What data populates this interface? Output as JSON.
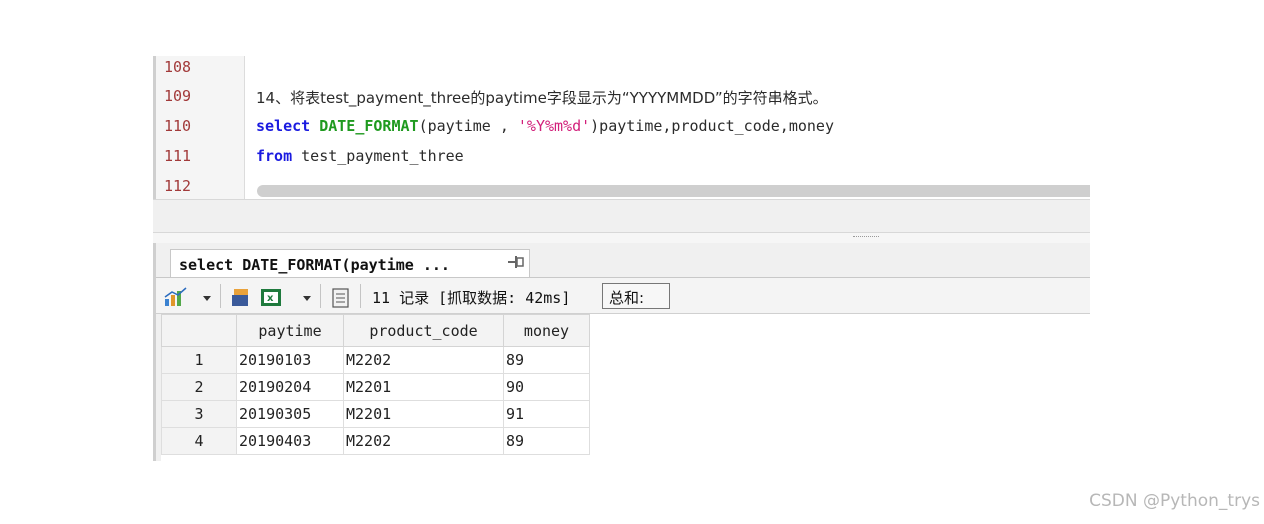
{
  "editor": {
    "lines": [
      {
        "num": "108",
        "text": ""
      },
      {
        "num": "109",
        "text": "14、将表test_payment_three的paytime字段显示为“YYYYMMDD”的字符串格式。"
      },
      {
        "num": "110",
        "kw1": "select",
        "fn": "DATE_FORMAT",
        "arg": "(paytime , ",
        "str": "'%Y%m%d'",
        "rest": ")paytime,product_code,money"
      },
      {
        "num": "111",
        "kw1": "from",
        "rest": " test_payment_three"
      },
      {
        "num": "112",
        "text": ""
      }
    ]
  },
  "results": {
    "tab_label": "select DATE_FORMAT(paytime ...",
    "pin_icon": "⊣⊨",
    "toolbar": {
      "records_text": "11 记录 [抓取数据: 42ms]",
      "summary_label": "总和:"
    },
    "columns": [
      "",
      "paytime",
      "product_code",
      "money"
    ],
    "rows": [
      [
        "1",
        "20190103",
        "M2202",
        "89"
      ],
      [
        "2",
        "20190204",
        "M2201",
        "90"
      ],
      [
        "3",
        "20190305",
        "M2201",
        "91"
      ],
      [
        "4",
        "20190403",
        "M2202",
        "89"
      ]
    ]
  },
  "watermark": "CSDN @Python_trys",
  "colors": {
    "keyword": "#1b1be0",
    "function": "#1f9a1f",
    "string": "#d21f7a",
    "line_number": "#a23a3a"
  }
}
